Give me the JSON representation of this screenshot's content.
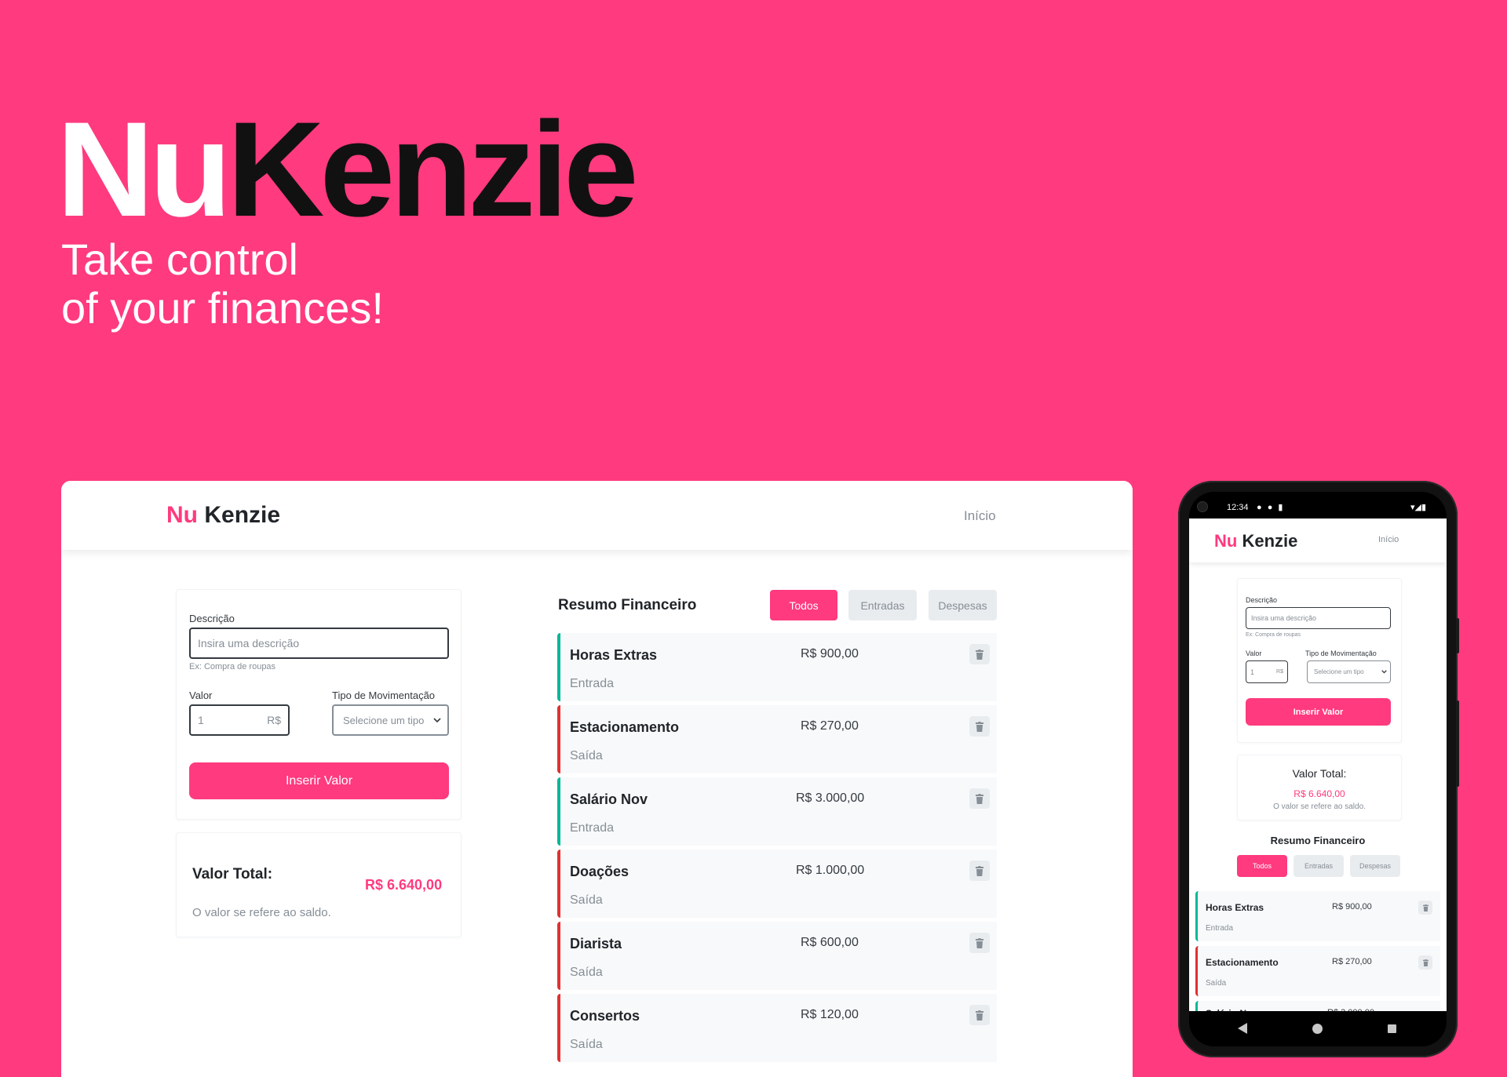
{
  "hero": {
    "title_nu": "Nu",
    "title_kenzie": "Kenzie",
    "subtitle_line1": "Take control",
    "subtitle_line2": "of your finances!"
  },
  "colors": {
    "brand_pink": "#FF3A7E",
    "entrada_green": "#03B898",
    "saida_red": "#E03131",
    "dark": "#212529",
    "gray": "#868E96"
  },
  "app": {
    "logo_nu": "Nu",
    "logo_kenzie": "Kenzie",
    "nav_inicio": "Início",
    "form": {
      "descricao_label": "Descrição",
      "descricao_placeholder": "Insira uma descrição",
      "descricao_hint": "Ex: Compra de roupas",
      "valor_label": "Valor",
      "valor_value": "1",
      "valor_currency": "R$",
      "tipo_label": "Tipo de Movimentação",
      "tipo_selected": "Selecione um tipo",
      "submit_label": "Inserir Valor"
    },
    "total": {
      "label": "Valor Total:",
      "amount": "R$ 6.640,00",
      "note": "O valor se refere ao saldo."
    },
    "resumo": {
      "title": "Resumo Financeiro",
      "filters": [
        "Todos",
        "Entradas",
        "Despesas"
      ],
      "active_filter": "Todos"
    },
    "transactions": [
      {
        "description": "Horas Extras",
        "amount": "R$ 900,00",
        "type": "Entrada"
      },
      {
        "description": "Estacionamento",
        "amount": "R$ 270,00",
        "type": "Saída"
      },
      {
        "description": "Salário Nov",
        "amount": "R$ 3.000,00",
        "type": "Entrada"
      },
      {
        "description": "Doações",
        "amount": "R$ 1.000,00",
        "type": "Saída"
      },
      {
        "description": "Diarista",
        "amount": "R$ 600,00",
        "type": "Saída"
      },
      {
        "description": "Consertos",
        "amount": "R$ 120,00",
        "type": "Saída"
      }
    ]
  },
  "phone": {
    "time": "12:34"
  }
}
